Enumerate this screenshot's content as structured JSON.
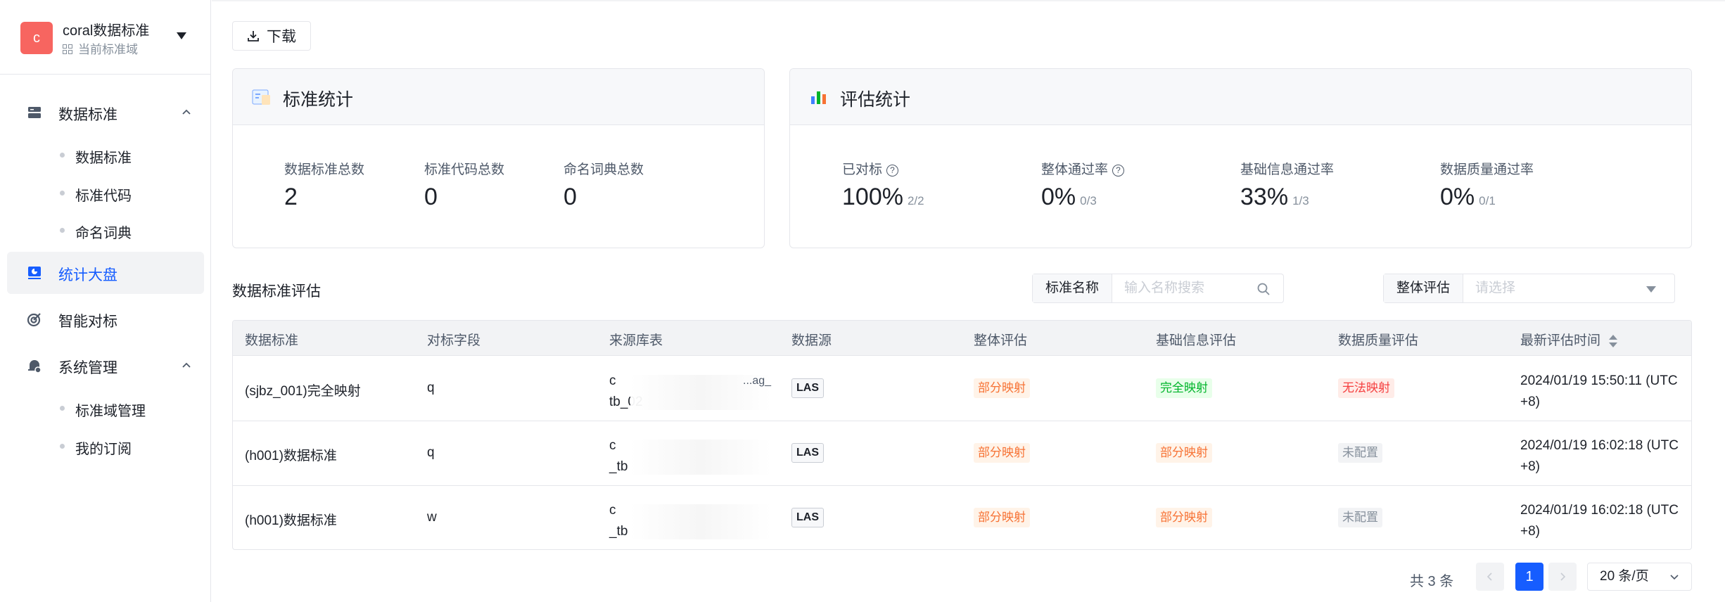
{
  "workspace": {
    "avatar": "c",
    "name": "coral数据标准",
    "sub": "当前标准域"
  },
  "sidebar": {
    "groups": [
      {
        "label": "数据标准",
        "items": [
          "数据标准",
          "标准代码",
          "命名词典"
        ]
      },
      {
        "label": "统计大盘"
      },
      {
        "label": "智能对标"
      },
      {
        "label": "系统管理",
        "items": [
          "标准域管理",
          "我的订阅"
        ]
      }
    ]
  },
  "toolbar": {
    "download": "下载"
  },
  "std_stats": {
    "title": "标准统计",
    "items": [
      {
        "label": "数据标准总数",
        "value": "2"
      },
      {
        "label": "标准代码总数",
        "value": "0"
      },
      {
        "label": "命名词典总数",
        "value": "0"
      }
    ]
  },
  "eval_stats": {
    "title": "评估统计",
    "items": [
      {
        "label": "已对标",
        "value": "100%",
        "frac": "2/2"
      },
      {
        "label": "整体通过率",
        "value": "0%",
        "frac": "0/3"
      },
      {
        "label": "基础信息通过率",
        "value": "33%",
        "frac": "1/3"
      },
      {
        "label": "数据质量通过率",
        "value": "0%",
        "frac": "0/1"
      }
    ]
  },
  "section": {
    "title": "数据标准评估",
    "filter_name_label": "标准名称",
    "filter_name_placeholder": "输入名称搜索",
    "filter_eval_label": "整体评估",
    "filter_eval_placeholder": "请选择"
  },
  "table": {
    "headers": [
      "数据标准",
      "对标字段",
      "来源库表",
      "数据源",
      "整体评估",
      "基础信息评估",
      "数据质量评估",
      "最新评估时间"
    ],
    "rows": [
      {
        "standard": "(sjbz_001)完全映射",
        "field": "q",
        "src1": "c",
        "src2": "tb_02",
        "src_tail": "...ag_",
        "datasource": "LAS",
        "overall": "部分映射",
        "basic": "完全映射",
        "quality": "无法映射",
        "time1": "2024/01/19 15:50:11 (UTC",
        "time2": "+8)"
      },
      {
        "standard": "(h001)数据标准",
        "field": "q",
        "src1": "c",
        "src2": "_tb",
        "src_tail": "",
        "datasource": "LAS",
        "overall": "部分映射",
        "basic": "部分映射",
        "quality": "未配置",
        "time1": "2024/01/19 16:02:18 (UTC",
        "time2": "+8)"
      },
      {
        "standard": "(h001)数据标准",
        "field": "w",
        "src1": "c",
        "src2": "_tb",
        "src_tail": "",
        "datasource": "LAS",
        "overall": "部分映射",
        "basic": "部分映射",
        "quality": "未配置",
        "time1": "2024/01/19 16:02:18 (UTC",
        "time2": "+8)"
      }
    ]
  },
  "pagination": {
    "total": "共 3 条",
    "current": "1",
    "page_size": "20 条/页"
  },
  "colors": {
    "primary": "#165dff",
    "avatar": "#f76560",
    "orange": "#f77234",
    "green": "#00b42a",
    "red": "#f53f3f"
  }
}
